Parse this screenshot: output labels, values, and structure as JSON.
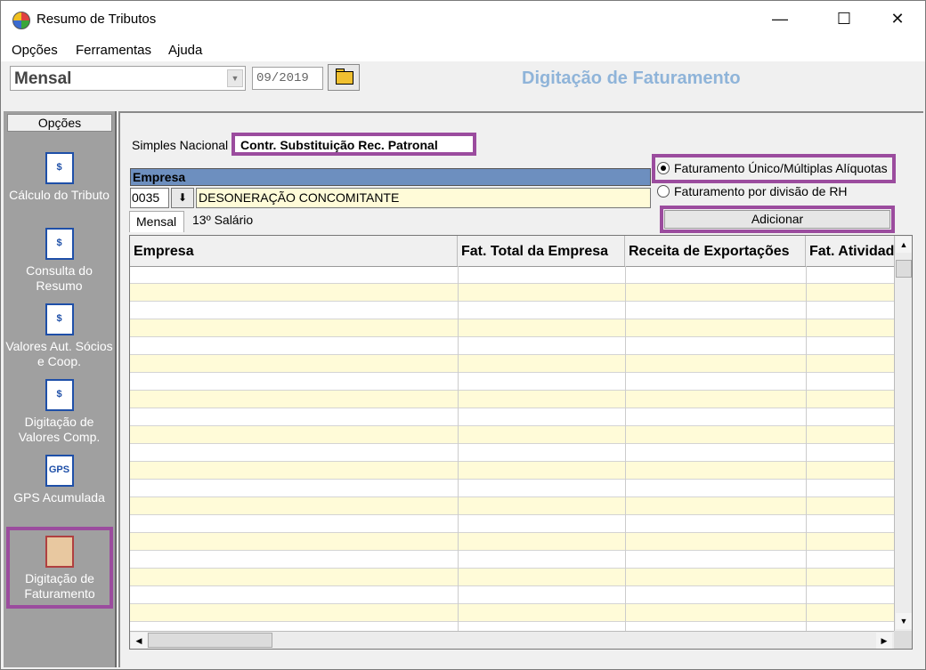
{
  "window": {
    "title": "Resumo de Tributos",
    "min": "—",
    "max": "☐",
    "close": "✕"
  },
  "menu": [
    "Opções",
    "Ferramentas",
    "Ajuda"
  ],
  "toolbar": {
    "period_type": "Mensal",
    "period_value": "09/2019",
    "page_heading": "Digitação de Faturamento"
  },
  "sidebar": {
    "header": "Opções",
    "items": [
      {
        "label": "Cálculo do Tributo",
        "icon": "calculator-document-icon",
        "icon_text": "$"
      },
      {
        "label": "Consulta do Resumo",
        "icon": "computer-dollar-icon",
        "icon_text": "$"
      },
      {
        "label": "Valores Aut. Sócios e  Coop.",
        "icon": "person-dollar-icon",
        "icon_text": "$"
      },
      {
        "label": "Digitação de Valores Comp.",
        "icon": "document-edit-dollar-icon",
        "icon_text": "$"
      },
      {
        "label": "GPS Acumulada",
        "icon": "gps-document-icon",
        "icon_text": "GPS"
      },
      {
        "label": "Digitação de Faturamento",
        "icon": "ledger-book-icon",
        "icon_text": ""
      }
    ]
  },
  "tabs": {
    "simples": "Simples Nacional",
    "contr": "Contr. Substituição Rec. Patronal"
  },
  "empresa": {
    "header": "Empresa",
    "code": "0035",
    "name": "DESONERAÇÃO CONCOMITANTE",
    "lookup_glyph": "⬇"
  },
  "options": {
    "radio1": "Faturamento Único/Múltiplas Alíquotas",
    "radio2": "Faturamento por divisão de RH",
    "selected": 1
  },
  "add_button": "Adicionar",
  "subtabs": [
    "Mensal",
    "13º Salário"
  ],
  "table": {
    "columns": [
      "Empresa",
      "Fat. Total da Empresa",
      "Receita de Exportações",
      "Fat. Atividades"
    ],
    "rows": []
  },
  "colors": {
    "accent_highlight": "#9b4c9e",
    "header_blue": "#6d8fbf",
    "row_alt": "#fffbd8",
    "heading_text": "#8fb4d9"
  }
}
